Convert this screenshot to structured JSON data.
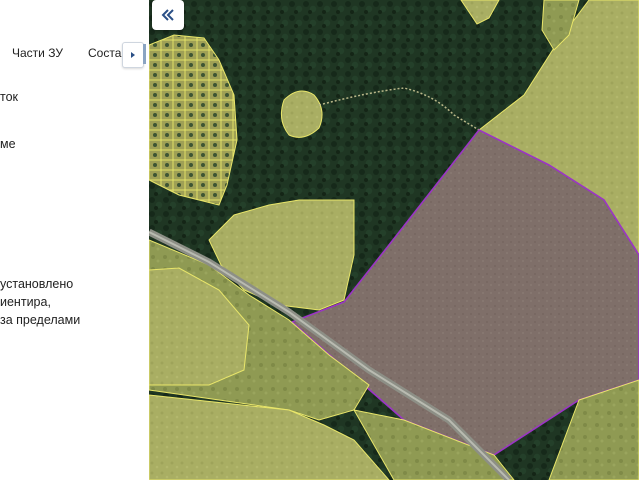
{
  "panel": {
    "tabs": [
      {
        "label": "Части ЗУ"
      },
      {
        "label": "Состав"
      }
    ],
    "text_lines": [
      "ток",
      "ме",
      "установлено",
      "иентира,",
      "за пределами"
    ]
  },
  "map": {
    "icons": {
      "collapse": "double-chevron-left-icon",
      "tab_scroll": "chevron-right-icon"
    },
    "colors": {
      "forest": "#1d3220",
      "field": "#a8ad62",
      "parcel_fill": "#7f6e6a",
      "parcel_border": "#9b34c6",
      "yellow_outline": "#e9e66a"
    }
  }
}
